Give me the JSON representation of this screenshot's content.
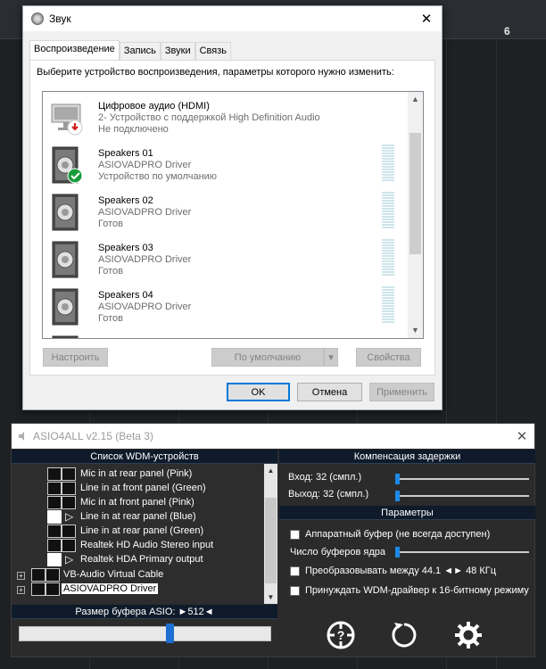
{
  "daw": {
    "ruler_marker": "6"
  },
  "sound_dialog": {
    "title": "Звук",
    "close": "✕",
    "tabs": [
      "Воспроизведение",
      "Запись",
      "Звуки",
      "Связь"
    ],
    "prompt": "Выберите устройство воспроизведения, параметры которого нужно изменить:",
    "devices": [
      {
        "name": "Цифровое аудио (HDMI)",
        "line2": "2- Устройство с поддержкой High Definition Audio",
        "status": "Не подключено",
        "icon": "monitor-icon",
        "badge": "disconnected-badge-icon",
        "badge_color": "#d32020"
      },
      {
        "name": "Speakers 01",
        "line2": "ASIOVADPRO Driver",
        "status": "Устройство по умолчанию",
        "icon": "speaker-icon",
        "badge": "default-check-badge-icon",
        "badge_color": "#1a9b3a"
      },
      {
        "name": "Speakers 02",
        "line2": "ASIOVADPRO Driver",
        "status": "Готов",
        "icon": "speaker-icon"
      },
      {
        "name": "Speakers 03",
        "line2": "ASIOVADPRO Driver",
        "status": "Готов",
        "icon": "speaker-icon"
      },
      {
        "name": "Speakers 04",
        "line2": "ASIOVADPRO Driver",
        "status": "Готов",
        "icon": "speaker-icon"
      }
    ],
    "buttons": {
      "configure": "Настроить",
      "set_default": "По умолчанию",
      "properties": "Свойства",
      "ok": "OK",
      "cancel": "Отмена",
      "apply": "Применить"
    },
    "accent": "#0078d7"
  },
  "asio": {
    "title": "ASIO4ALL v2.15 (Beta 3)",
    "close": "✕",
    "wdm_header": "Список WDM-устройств",
    "latency_header": "Компенсация задержки",
    "params_header": "Параметры",
    "wdm_items": [
      {
        "label": "Mic in at rear panel (Pink)",
        "icon": "pencil-icon",
        "active": false
      },
      {
        "label": "Line in at front panel (Green)",
        "icon": "pencil-icon",
        "active": false
      },
      {
        "label": "Mic in at front panel (Pink)",
        "icon": "pencil-icon",
        "active": false
      },
      {
        "label": "Line in at rear panel (Blue)",
        "icon": "pencil-icon",
        "active": true
      },
      {
        "label": "Line in at rear panel (Green)",
        "icon": "pencil-icon",
        "active": false
      },
      {
        "label": "Realtek HD Audio Stereo input",
        "icon": "pencil-icon",
        "active": false
      },
      {
        "label": "Realtek HDA Primary output",
        "icon": "speaker-small-icon",
        "active": true
      }
    ],
    "drivers": [
      {
        "label": "VB-Audio Virtual Cable",
        "selected": false
      },
      {
        "label": "ASIOVADPRO Driver",
        "selected": true
      }
    ],
    "latency": {
      "input_label": "Вход: 32 (смпл.)",
      "output_label": "Выход: 32 (смпл.)"
    },
    "options": [
      {
        "label": "Аппаратный буфер (не всегда доступен)",
        "checked": false
      },
      {
        "label": "Число буферов ядра",
        "checked": null
      },
      {
        "label": "Преобразовывать между 44.1 ◄► 48 КГц",
        "checked": false
      },
      {
        "label": "Принуждать WDM-драйвер к 16-битному режиму",
        "checked": false
      }
    ],
    "buffer_label": "Размер буфера ASIO: ►512◄",
    "buffer_value": 512,
    "accent": "#1e88e5"
  }
}
